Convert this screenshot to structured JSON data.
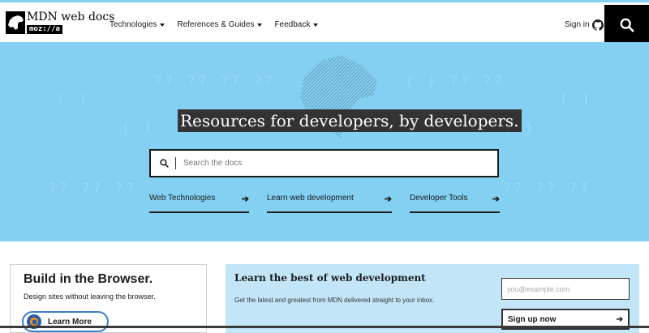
{
  "header": {
    "logo_title": "MDN web docs",
    "logo_sub": "moz://a",
    "nav": [
      {
        "label": "Technologies"
      },
      {
        "label": "References & Guides"
      },
      {
        "label": "Feedback"
      }
    ],
    "signin_label": "Sign in",
    "icons": {
      "signin": "github-icon",
      "search": "search-icon"
    }
  },
  "hero": {
    "title": "Resources for developers, by developers.",
    "search_placeholder": "Search the docs",
    "links": [
      {
        "label": "Web Technologies",
        "arrow": "➔"
      },
      {
        "label": "Learn web development",
        "arrow": "➔"
      },
      {
        "label": "Developer Tools",
        "arrow": "➔"
      }
    ]
  },
  "build": {
    "title": "Build in the Browser.",
    "text": "Design sites without leaving the browser.",
    "button_label": "Learn More"
  },
  "newsletter": {
    "title": "Learn the best of web development",
    "text": "Get the latest and greatest from MDN delivered straight to your inbox.",
    "email_placeholder": "you@example.com",
    "signup_label": "Sign up now",
    "signup_arrow": "➔"
  },
  "colors": {
    "hero_bg": "#83d0f2",
    "newsletter_bg": "#c2e6f7",
    "dark": "#1b1b1b"
  }
}
